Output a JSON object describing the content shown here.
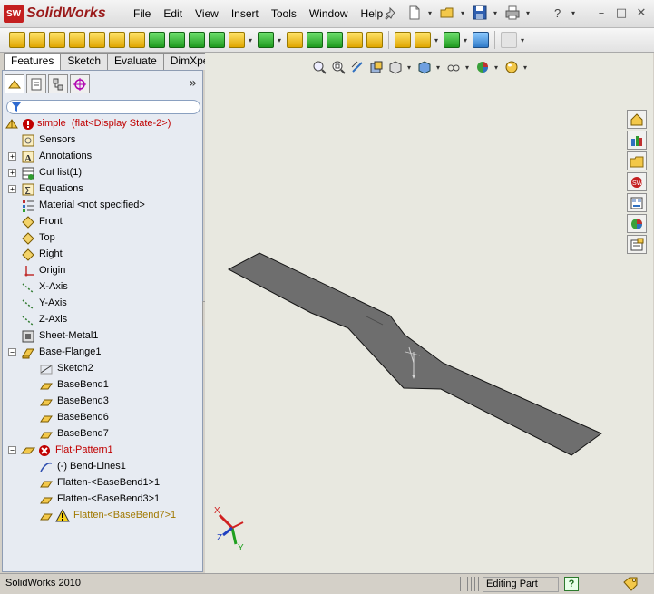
{
  "app": {
    "name": "SolidWorks",
    "badge": "SW"
  },
  "menu": {
    "items": [
      "File",
      "Edit",
      "View",
      "Insert",
      "Tools",
      "Window",
      "Help"
    ]
  },
  "tabs": [
    "Features",
    "Sketch",
    "Evaluate",
    "DimXpert"
  ],
  "panel": {
    "expand_glyph": "»"
  },
  "tree": {
    "root": {
      "name": "simple",
      "state": "(flat<Display State-2>)"
    },
    "items": [
      {
        "label": "Sensors",
        "icon": "sensors-icon"
      },
      {
        "label": "Annotations",
        "icon": "annotations-icon"
      },
      {
        "label": "Cut list(1)",
        "icon": "cut-list-icon"
      },
      {
        "label": "Equations",
        "icon": "equations-icon"
      },
      {
        "label": "Material <not specified>",
        "icon": "material-icon"
      },
      {
        "label": "Front",
        "icon": "plane-icon"
      },
      {
        "label": "Top",
        "icon": "plane-icon"
      },
      {
        "label": "Right",
        "icon": "plane-icon"
      },
      {
        "label": "Origin",
        "icon": "origin-icon"
      },
      {
        "label": "X-Axis",
        "icon": "axis-icon"
      },
      {
        "label": "Y-Axis",
        "icon": "axis-icon"
      },
      {
        "label": "Z-Axis",
        "icon": "axis-icon"
      },
      {
        "label": "Sheet-Metal1",
        "icon": "sheet-metal-icon"
      },
      {
        "label": "Base-Flange1",
        "icon": "base-flange-icon"
      },
      {
        "label": "Sketch2",
        "icon": "sketch-icon"
      },
      {
        "label": "BaseBend1",
        "icon": "bend-icon"
      },
      {
        "label": "BaseBend3",
        "icon": "bend-icon"
      },
      {
        "label": "BaseBend6",
        "icon": "bend-icon"
      },
      {
        "label": "BaseBend7",
        "icon": "bend-icon"
      },
      {
        "label": "Flat-Pattern1",
        "icon": "flat-pattern-icon"
      },
      {
        "label": "(-) Bend-Lines1",
        "icon": "bend-lines-sketch-icon"
      },
      {
        "label": "Flatten-<BaseBend1>1",
        "icon": "flatten-icon"
      },
      {
        "label": "Flatten-<BaseBend3>1",
        "icon": "flatten-icon"
      },
      {
        "label": "Flatten-<BaseBend7>1",
        "icon": "flatten-warning-icon"
      }
    ]
  },
  "triad": {
    "x": "X",
    "y": "Y",
    "z": "Z"
  },
  "status": {
    "app_version": "SolidWorks 2010",
    "mode": "Editing Part",
    "help": "?"
  },
  "colors": {
    "part_face": "#6e6e6e",
    "part_edge": "#141414",
    "viewport_bg": "#e8e8e0",
    "error_red": "#c00000",
    "rollback_blue": "#2f6bd0"
  }
}
